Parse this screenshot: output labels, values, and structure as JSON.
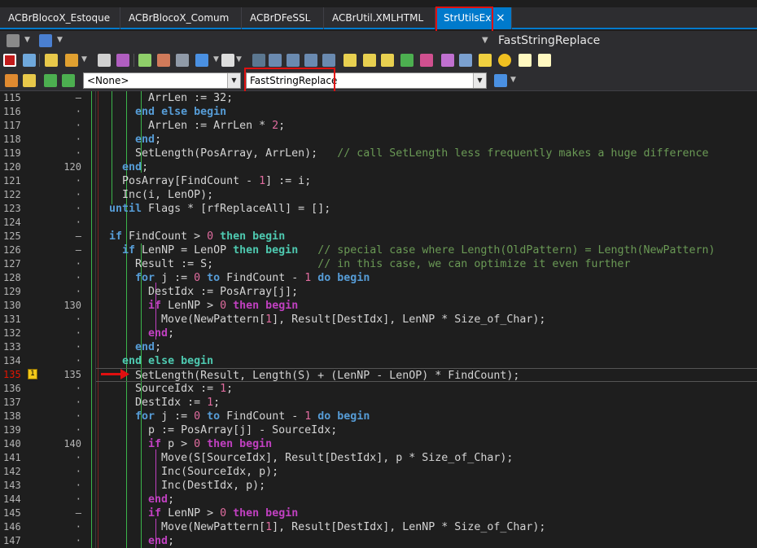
{
  "tabs": [
    {
      "label": "ACBrBlocoX_Estoque"
    },
    {
      "label": "ACBrBlocoX_Comum"
    },
    {
      "label": "ACBrDFeSSL"
    },
    {
      "label": "ACBrUtil.XMLHTML"
    },
    {
      "label": "StrUtilsEx",
      "active": true,
      "close": "×"
    }
  ],
  "nav_title": "FastStringReplace",
  "class_combo": {
    "value": "<None>"
  },
  "method_combo": {
    "value": "FastStringReplace"
  },
  "colors": {
    "keyword": "#569cd6",
    "keyword_block": "#c040c0",
    "keyword_loop": "#4ec9b0",
    "number": "#e06c9f",
    "comment": "#6a9955",
    "highlight": "#e01010",
    "accent": "#007acc"
  },
  "bookmark": "1",
  "gutter": [
    {
      "n": "115",
      "m": "–"
    },
    {
      "n": "116",
      "m": "·"
    },
    {
      "n": "117",
      "m": "·"
    },
    {
      "n": "118",
      "m": "·"
    },
    {
      "n": "119",
      "m": "·"
    },
    {
      "n": "120",
      "m": "120"
    },
    {
      "n": "121",
      "m": "·"
    },
    {
      "n": "122",
      "m": "·"
    },
    {
      "n": "123",
      "m": "·"
    },
    {
      "n": "124",
      "m": "·"
    },
    {
      "n": "125",
      "m": "–"
    },
    {
      "n": "126",
      "m": "–"
    },
    {
      "n": "127",
      "m": "·"
    },
    {
      "n": "128",
      "m": "·"
    },
    {
      "n": "129",
      "m": "·"
    },
    {
      "n": "130",
      "m": "130"
    },
    {
      "n": "131",
      "m": "·"
    },
    {
      "n": "132",
      "m": "·"
    },
    {
      "n": "133",
      "m": "·"
    },
    {
      "n": "134",
      "m": "·"
    },
    {
      "n": "135",
      "m": "135"
    },
    {
      "n": "136",
      "m": "·"
    },
    {
      "n": "137",
      "m": "·"
    },
    {
      "n": "138",
      "m": "·"
    },
    {
      "n": "139",
      "m": "·"
    },
    {
      "n": "140",
      "m": "140"
    },
    {
      "n": "141",
      "m": "·"
    },
    {
      "n": "142",
      "m": "·"
    },
    {
      "n": "143",
      "m": "·"
    },
    {
      "n": "144",
      "m": "·"
    },
    {
      "n": "145",
      "m": "–"
    },
    {
      "n": "146",
      "m": "·"
    },
    {
      "n": "147",
      "m": "·"
    }
  ],
  "code": [
    [
      [
        "        ",
        ""
      ],
      [
        "ArrLen := ",
        ""
      ],
      [
        "32",
        ""
      ],
      [
        ";",
        ""
      ]
    ],
    [
      [
        "      ",
        ""
      ],
      [
        "end else begin",
        "kw"
      ]
    ],
    [
      [
        "        ArrLen := ArrLen * ",
        ""
      ],
      [
        "2",
        "num"
      ],
      [
        ";",
        ""
      ]
    ],
    [
      [
        "      ",
        ""
      ],
      [
        "end",
        "kw"
      ],
      [
        ";",
        ""
      ]
    ],
    [
      [
        "      SetLength(PosArray, ArrLen);   ",
        ""
      ],
      [
        "// call SetLength less frequently makes a huge difference",
        "cm"
      ]
    ],
    [
      [
        "    ",
        ""
      ],
      [
        "end",
        "kw"
      ],
      [
        ";",
        ""
      ]
    ],
    [
      [
        "    PosArray[FindCount - ",
        ""
      ],
      [
        "1",
        "num"
      ],
      [
        "] := i;",
        ""
      ]
    ],
    [
      [
        "    Inc(i, LenOP);",
        ""
      ]
    ],
    [
      [
        "  ",
        ""
      ],
      [
        "until",
        "kw"
      ],
      [
        " Flags * [rfReplaceAll] = [];",
        ""
      ]
    ],
    [
      [
        "",
        ""
      ]
    ],
    [
      [
        "  ",
        ""
      ],
      [
        "if",
        "kw"
      ],
      [
        " FindCount > ",
        ""
      ],
      [
        "0",
        "num"
      ],
      [
        " ",
        ""
      ],
      [
        "then begin",
        "kwg"
      ]
    ],
    [
      [
        "    ",
        ""
      ],
      [
        "if",
        "kw"
      ],
      [
        " LenNP = LenOP ",
        ""
      ],
      [
        "then begin",
        "kwg"
      ],
      [
        "   ",
        ""
      ],
      [
        "// special case where Length(OldPattern) = Length(NewPattern)",
        "cm"
      ]
    ],
    [
      [
        "      Result := S;                ",
        ""
      ],
      [
        "// in this case, we can optimize it even further",
        "cm"
      ]
    ],
    [
      [
        "      ",
        ""
      ],
      [
        "for",
        "kw"
      ],
      [
        " j := ",
        ""
      ],
      [
        "0",
        "num"
      ],
      [
        " ",
        ""
      ],
      [
        "to",
        "kw"
      ],
      [
        " FindCount - ",
        ""
      ],
      [
        "1",
        "num"
      ],
      [
        " ",
        ""
      ],
      [
        "do begin",
        "kw"
      ]
    ],
    [
      [
        "        DestIdx := PosArray[j];",
        ""
      ]
    ],
    [
      [
        "        ",
        ""
      ],
      [
        "if",
        "kwm"
      ],
      [
        " LenNP > ",
        ""
      ],
      [
        "0",
        "num"
      ],
      [
        " ",
        ""
      ],
      [
        "then begin",
        "kwm"
      ]
    ],
    [
      [
        "          Move(NewPattern[",
        ""
      ],
      [
        "1",
        "num"
      ],
      [
        "], Result[DestIdx], LenNP * Size_of_Char);",
        ""
      ]
    ],
    [
      [
        "        ",
        ""
      ],
      [
        "end",
        "kwm"
      ],
      [
        ";",
        ""
      ]
    ],
    [
      [
        "      ",
        ""
      ],
      [
        "end",
        "kw"
      ],
      [
        ";",
        ""
      ]
    ],
    [
      [
        "    ",
        ""
      ],
      [
        "end else begin",
        "kwg"
      ]
    ],
    [
      [
        "      SetLength(Result, Length(S) + (LenNP - LenOP) * FindCount);",
        ""
      ]
    ],
    [
      [
        "      SourceIdx := ",
        ""
      ],
      [
        "1",
        "num"
      ],
      [
        ";",
        ""
      ]
    ],
    [
      [
        "      DestIdx := ",
        ""
      ],
      [
        "1",
        "num"
      ],
      [
        ";",
        ""
      ]
    ],
    [
      [
        "      ",
        ""
      ],
      [
        "for",
        "kw"
      ],
      [
        " j := ",
        ""
      ],
      [
        "0",
        "num"
      ],
      [
        " ",
        ""
      ],
      [
        "to",
        "kw"
      ],
      [
        " FindCount - ",
        ""
      ],
      [
        "1",
        "num"
      ],
      [
        " ",
        ""
      ],
      [
        "do begin",
        "kw"
      ]
    ],
    [
      [
        "        p := PosArray[j] - SourceIdx;",
        ""
      ]
    ],
    [
      [
        "        ",
        ""
      ],
      [
        "if",
        "kwm"
      ],
      [
        " p > ",
        ""
      ],
      [
        "0",
        "num"
      ],
      [
        " ",
        ""
      ],
      [
        "then begin",
        "kwm"
      ]
    ],
    [
      [
        "          Move(S[SourceIdx], Result[DestIdx], p * Size_of_Char);",
        ""
      ]
    ],
    [
      [
        "          Inc(SourceIdx, p);",
        ""
      ]
    ],
    [
      [
        "          Inc(DestIdx, p);",
        ""
      ]
    ],
    [
      [
        "        ",
        ""
      ],
      [
        "end",
        "kwm"
      ],
      [
        ";",
        ""
      ]
    ],
    [
      [
        "        ",
        ""
      ],
      [
        "if",
        "kwm"
      ],
      [
        " LenNP > ",
        ""
      ],
      [
        "0",
        "num"
      ],
      [
        " ",
        ""
      ],
      [
        "then begin",
        "kwm"
      ]
    ],
    [
      [
        "          Move(NewPattern[",
        ""
      ],
      [
        "1",
        "num"
      ],
      [
        "], Result[DestIdx], LenNP * Size_of_Char);",
        ""
      ]
    ],
    [
      [
        "        ",
        ""
      ],
      [
        "end",
        "kwm"
      ],
      [
        ";",
        ""
      ]
    ]
  ]
}
